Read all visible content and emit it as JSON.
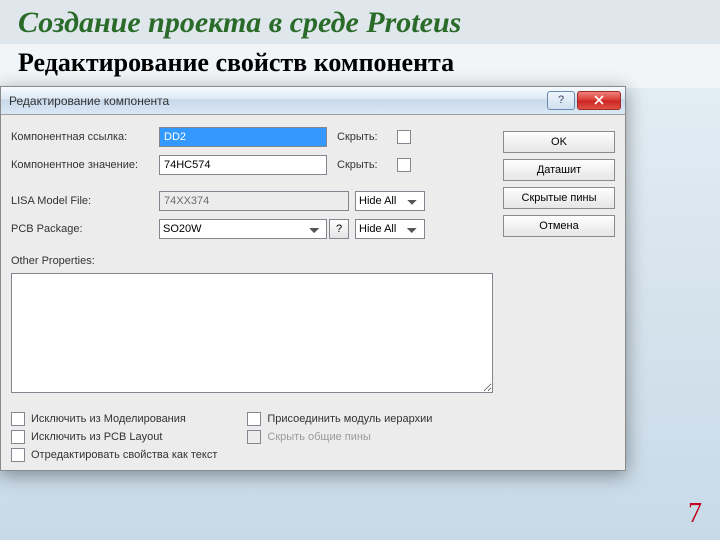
{
  "slide": {
    "title": "Создание проекта в среде Proteus",
    "subtitle": "Редактирование свойств компонента",
    "page": "7"
  },
  "dialog": {
    "title": "Редактирование компонента",
    "labels": {
      "ref": "Компонентная ссылка:",
      "value": "Компонентное значение:",
      "lisa": "LISA Model File:",
      "pcb": "PCB Package:",
      "other": "Other Properties:",
      "hide1": "Скрыть:",
      "hide2": "Скрыть:"
    },
    "fields": {
      "ref": "DD2",
      "value": "74HC574",
      "lisa": "74XX374",
      "pcb": "SO20W",
      "lisa_vis": "Hide All",
      "pcb_vis": "Hide All"
    },
    "buttons": {
      "ok": "OK",
      "datasheet": "Даташит",
      "hidden_pins": "Скрытые пины",
      "cancel": "Отмена",
      "q": "?"
    },
    "checks": {
      "exclude_sim": "Исключить из Моделирования",
      "exclude_pcb": "Исключить из PCB Layout",
      "edit_as_text": "Отредактировать свойства как текст",
      "attach_hier": "Присоединить модуль иерархии",
      "hide_common": "Скрыть общие пины"
    }
  }
}
